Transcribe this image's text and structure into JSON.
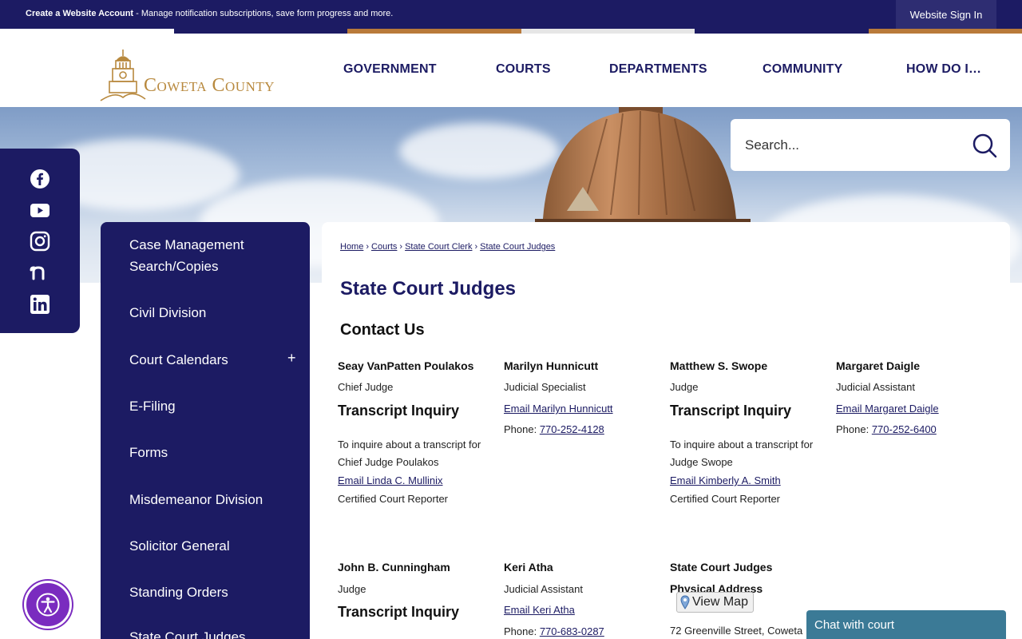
{
  "topbar": {
    "account_strong": "Create a Website Account",
    "account_rest": " - Manage notification subscriptions, save form progress and more.",
    "signin": "Website Sign In"
  },
  "colors": {
    "brand_navy": "#1c1b63",
    "gold": "#b8893e",
    "accent_orange": "#b97a3a",
    "chat_teal": "#3b7a96",
    "access_purple": "#7a2bbf"
  },
  "logo": {
    "text": "Coweta County",
    "icon": "courthouse-tower-icon"
  },
  "nav": [
    "GOVERNMENT",
    "COURTS",
    "DEPARTMENTS",
    "COMMUNITY",
    "HOW DO I…"
  ],
  "search": {
    "placeholder": "Search..."
  },
  "social": [
    "facebook-icon",
    "youtube-icon",
    "instagram-icon",
    "nextdoor-icon",
    "linkedin-icon"
  ],
  "sidenav": {
    "items": [
      "Case Management Search/Copies",
      "Civil Division",
      "Court Calendars",
      "E-Filing",
      "Forms",
      "Misdemeanor Division",
      "Solicitor General",
      "Standing Orders",
      "State Court Judges"
    ],
    "expand": "+"
  },
  "breadcrumb": [
    "Home",
    "Courts",
    "State Court Clerk",
    "State Court Judges"
  ],
  "page": {
    "title": "State Court Judges",
    "contact_heading": "Contact Us"
  },
  "contacts": {
    "c1": {
      "name": "Seay VanPatten Poulakos",
      "title": "Chief Judge",
      "transcript_heading": "Transcript Inquiry",
      "inquiry_line1": "To inquire about a transcript for",
      "inquiry_line2": "Chief Judge Poulakos",
      "email": "Email Linda C. Mullinix",
      "role": "Certified Court Reporter"
    },
    "c2": {
      "name": "Marilyn Hunnicutt",
      "title": "Judicial Specialist",
      "email": "Email Marilyn Hunnicutt",
      "phone_label": "Phone: ",
      "phone": "770-252-4128"
    },
    "c3": {
      "name": "Matthew S. Swope",
      "title": "Judge",
      "transcript_heading": "Transcript Inquiry",
      "inquiry_line1": "To inquire about a transcript for",
      "inquiry_line2": "Judge Swope",
      "email": "Email Kimberly A. Smith",
      "role": "Certified Court Reporter"
    },
    "c4": {
      "name": "Margaret Daigle",
      "title": "Judicial Assistant",
      "email": "Email Margaret Daigle",
      "phone_label": "Phone: ",
      "phone": "770-252-6400"
    },
    "c5": {
      "name": "John B. Cunningham",
      "title": "Judge",
      "transcript_heading": "Transcript Inquiry"
    },
    "c6": {
      "name": "Keri Atha",
      "title": "Judicial Assistant",
      "email": "Email Keri Atha",
      "phone_label": "Phone: ",
      "phone": "770-683-0287"
    },
    "c7": {
      "name": "State Court Judges",
      "address_heading": "Physical Address",
      "view_map": "View Map",
      "address": "72 Greenville Street, Coweta"
    }
  },
  "chat": {
    "label": "Chat with court"
  },
  "accessibility": {
    "icon": "accessibility-person-icon"
  }
}
